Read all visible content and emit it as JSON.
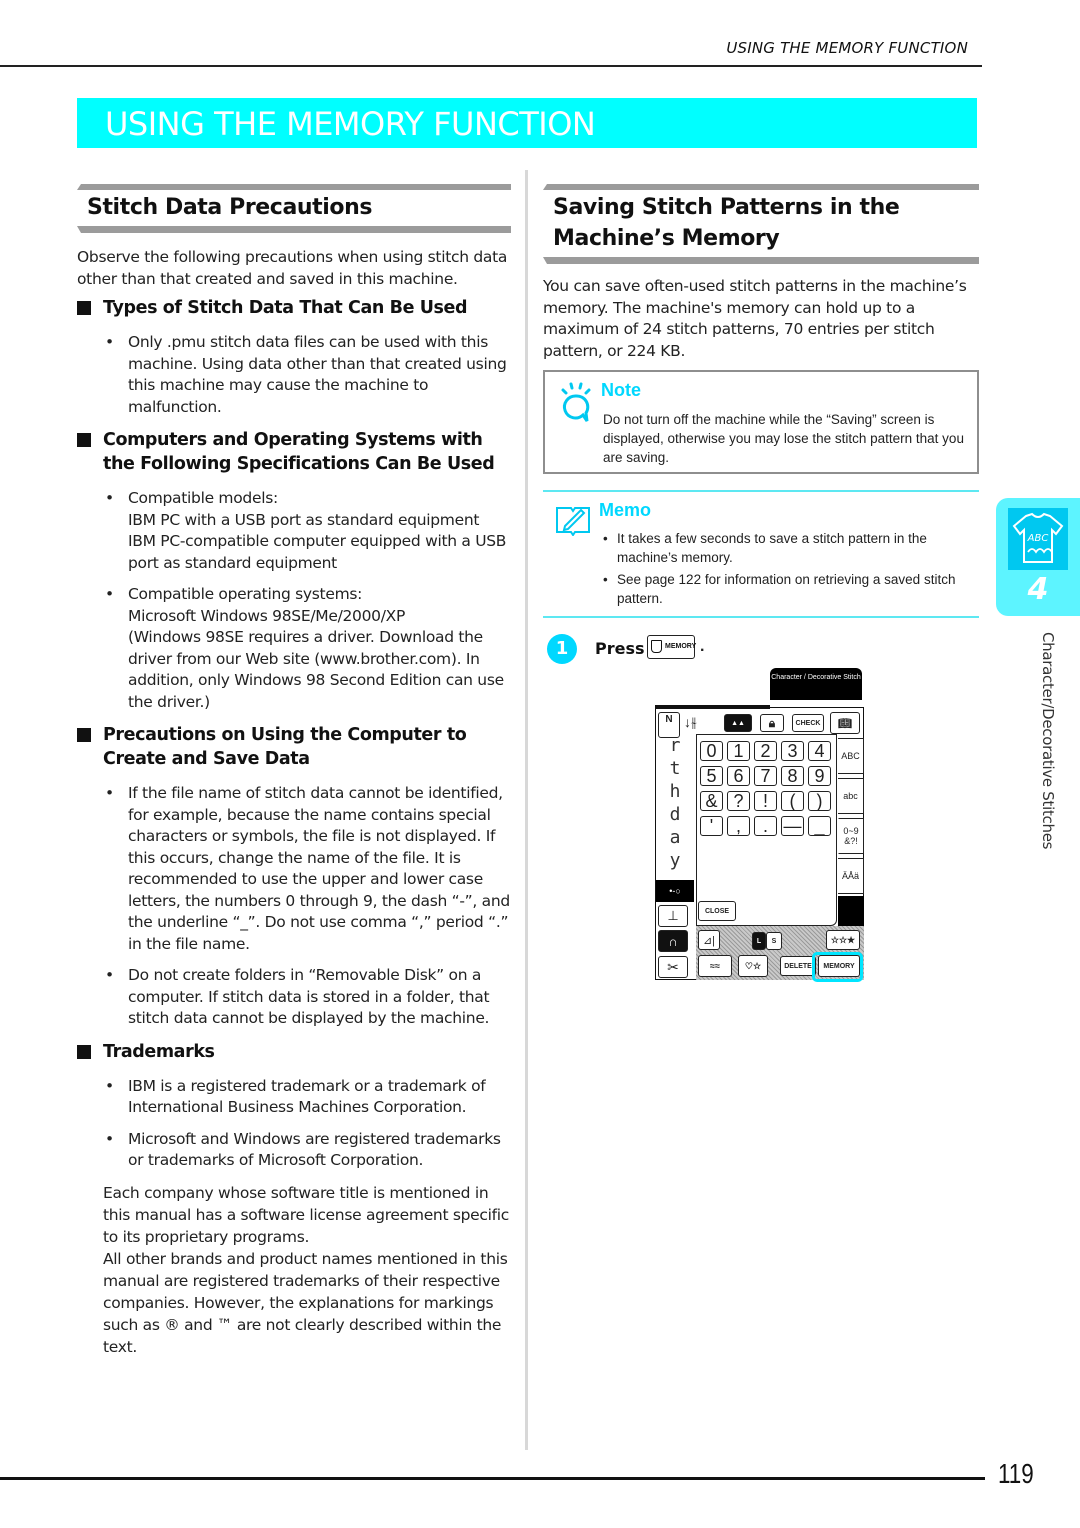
{
  "running_head": "USING THE MEMORY FUNCTION",
  "banner_title": "USING THE MEMORY FUNCTION",
  "left": {
    "section_title": "Stitch Data Precautions",
    "intro": "Observe the following precautions when using stitch data other than that created and saved in this machine.",
    "subsections": [
      {
        "title": "Types of Stitch Data That Can Be Used",
        "bullets": [
          [
            "Only .pmu stitch data files can be used with this machine. Using data other than that created using this machine may cause the machine to malfunction."
          ]
        ]
      },
      {
        "title": "Computers and Operating Systems with the Following Specifications Can Be Used",
        "bullets": [
          [
            "Compatible models:",
            "IBM PC with a USB port as standard equipment",
            "IBM PC-compatible computer equipped with a USB port as standard equipment"
          ],
          [
            "Compatible operating systems:",
            "Microsoft Windows 98SE/Me/2000/XP",
            "(Windows 98SE requires a driver. Download the driver from our Web site (www.brother.com). In addition, only Windows 98 Second Edition can use the driver.)"
          ]
        ]
      },
      {
        "title": "Precautions on Using the Computer to Create and Save Data",
        "bullets": [
          [
            "If the file name of stitch data cannot be identified, for example, because the name contains special characters or symbols, the file is not displayed. If this occurs, change the name of the file. It is recommended to use the upper and lower case letters, the numbers 0 through 9, the dash “-”, and the underline “_”. Do not use comma “,” period “.” in the file name."
          ],
          [
            "Do not create folders in “Removable Disk” on a computer. If stitch data is stored in a folder, that stitch data cannot be displayed by the machine."
          ]
        ]
      },
      {
        "title": "Trademarks",
        "bullets": [
          [
            "IBM is a registered trademark or a trademark of International Business Machines Corporation."
          ],
          [
            "Microsoft and Windows are registered trademarks or trademarks of Microsoft Corporation."
          ]
        ]
      }
    ],
    "closing_1": "Each company whose software title is mentioned in this manual has a software license agreement specific to its proprietary programs.",
    "closing_2": "All other brands and product names mentioned in this manual are registered trademarks of their respective companies. However, the explanations for markings such as ® and ™ are not clearly described within the text."
  },
  "right": {
    "section_title_1": "Saving Stitch Patterns in the",
    "section_title_2": "Machine’s Memory",
    "intro": "You can save often-used stitch patterns in the machine’s memory. The machine's memory can hold up to a maximum of 24 stitch patterns, 70 entries per stitch pattern, or 224 KB.",
    "note": {
      "title": "Note",
      "text": "Do not turn off the machine while the “Saving” screen is displayed, otherwise you may lose the stitch pattern that you are saving."
    },
    "memo": {
      "title": "Memo",
      "items": [
        "It takes a few seconds to save a stitch pattern in the machine’s memory.",
        "See page 122 for information on retrieving a saved stitch pattern."
      ]
    },
    "step": {
      "number": "1",
      "label": "Press",
      "key_label": "MEMORY",
      "end": "."
    },
    "screen": {
      "tab_title": "Character / Decorative Stitch",
      "top_keys": [
        "CHECK"
      ],
      "number_keys": [
        "0",
        "1",
        "2",
        "3",
        "4",
        "5",
        "6",
        "7",
        "8",
        "9",
        "&",
        "?",
        "!",
        "(",
        ")",
        "'",
        ",",
        ".",
        "—",
        "_"
      ],
      "side_glyphs": [
        "r",
        "t",
        "h",
        "d",
        "a",
        "y"
      ],
      "right_tabs": [
        "ABC",
        "abc",
        "0~9 &?!",
        "ÄÅä"
      ],
      "close_label": "CLOSE",
      "size_L": "L",
      "size_S": "S",
      "delete_label": "DELETE",
      "memory_label": "MEMORY",
      "n_label": "N"
    }
  },
  "side_tab": {
    "chapter": "4",
    "icon_text": "ABC",
    "label": "Character/Decorative Stitches"
  },
  "page_number": "119",
  "colors": {
    "accent": "#00ffff",
    "note_title": "#00d8ff",
    "highlight": "#00e5ff"
  }
}
